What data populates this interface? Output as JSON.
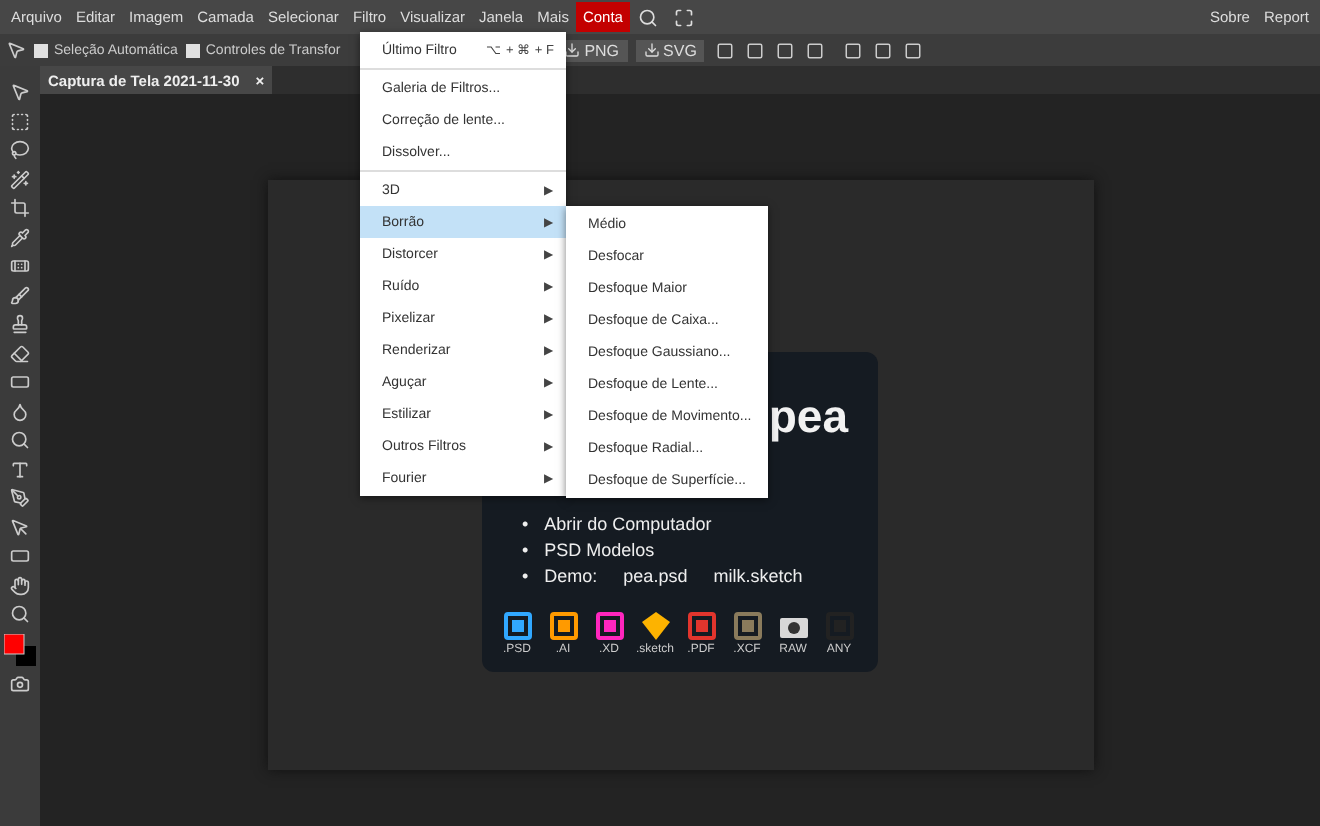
{
  "menubar": {
    "items": [
      {
        "label": "Arquivo",
        "highlighted": false
      },
      {
        "label": "Editar",
        "highlighted": false
      },
      {
        "label": "Imagem",
        "highlighted": false
      },
      {
        "label": "Camada",
        "highlighted": false
      },
      {
        "label": "Selecionar",
        "highlighted": false
      },
      {
        "label": "Filtro",
        "highlighted": false
      },
      {
        "label": "Visualizar",
        "highlighted": false
      },
      {
        "label": "Janela",
        "highlighted": false
      },
      {
        "label": "Mais",
        "highlighted": false
      },
      {
        "label": "Conta",
        "highlighted": true
      }
    ],
    "right_links": [
      "Sobre",
      "Report"
    ]
  },
  "options_bar": {
    "checkboxes": [
      {
        "label": "Seleção Automática",
        "checked": false
      },
      {
        "label": "Controles de Transfor",
        "checked": false
      }
    ],
    "export_buttons": [
      "PNG",
      "SVG"
    ]
  },
  "tabs": [
    {
      "label": "Captura de Tela 2021-11-30",
      "close": "×",
      "selected": true
    }
  ],
  "filter_menu": {
    "items": [
      {
        "kind": "item",
        "label": "Último Filtro",
        "shortcut": "⌥ + ⌘ + F",
        "selected": false
      },
      {
        "kind": "separator"
      },
      {
        "kind": "item",
        "label": "Galeria de Filtros...",
        "selected": false
      },
      {
        "kind": "item",
        "label": "Correção de lente...",
        "selected": false
      },
      {
        "kind": "item",
        "label": "Dissolver...",
        "selected": false
      },
      {
        "kind": "separator"
      },
      {
        "kind": "submenu",
        "label": "3D",
        "selected": false
      },
      {
        "kind": "submenu",
        "label": "Borrão",
        "selected": true
      },
      {
        "kind": "submenu",
        "label": "Distorcer",
        "selected": false
      },
      {
        "kind": "submenu",
        "label": "Ruído",
        "selected": false
      },
      {
        "kind": "submenu",
        "label": "Pixelizar",
        "selected": false
      },
      {
        "kind": "submenu",
        "label": "Renderizar",
        "selected": false
      },
      {
        "kind": "submenu",
        "label": "Aguçar",
        "selected": false
      },
      {
        "kind": "submenu",
        "label": "Estilizar",
        "selected": false
      },
      {
        "kind": "submenu",
        "label": "Outros Filtros",
        "selected": false
      },
      {
        "kind": "submenu",
        "label": "Fourier",
        "selected": false
      }
    ],
    "submenu_arrow": "▶",
    "submenu": [
      "Médio",
      "Desfocar",
      "Desfoque Maior",
      "Desfoque de Caixa...",
      "Desfoque Gaussiano...",
      "Desfoque de Lente...",
      "Desfoque de Movimento...",
      "Desfoque Radial...",
      "Desfoque de Superfície..."
    ]
  },
  "welcome": {
    "title": "pea",
    "bullet": "•",
    "links": [
      "Abrir do Computador",
      "PSD Modelos"
    ],
    "demo": {
      "label": "Demo:",
      "files": [
        "pea.psd",
        "milk.sketch"
      ]
    },
    "formats": [
      {
        "label": ".PSD",
        "color": "#31a8ff"
      },
      {
        "label": ".AI",
        "color": "#ff9a00"
      },
      {
        "label": ".XD",
        "color": "#ff26be"
      },
      {
        "label": ".sketch",
        "color": "#fdb300"
      },
      {
        "label": ".PDF",
        "color": "#e2352d"
      },
      {
        "label": ".XCF",
        "color": "#8a7b5c"
      },
      {
        "label": "RAW",
        "color": "#d8d8d8"
      },
      {
        "label": "ANY",
        "color": "#222222"
      }
    ]
  }
}
